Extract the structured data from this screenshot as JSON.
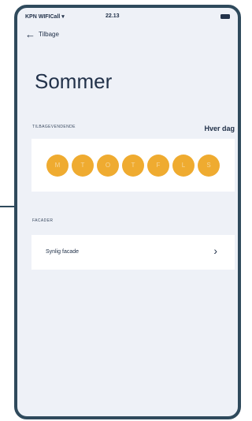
{
  "status_bar": {
    "carrier": "KPN WIFICall",
    "time": "22.13"
  },
  "nav": {
    "back_label": "Tilbage"
  },
  "title": "Sommer",
  "schedule": {
    "section_label": "TILBAGEVENDENDE",
    "repeat_value": "Hver dag",
    "days": [
      "M",
      "T",
      "O",
      "T",
      "F",
      "L",
      "S"
    ],
    "active_color": "#efab30"
  },
  "facades": {
    "section_label": "FACADER",
    "items": [
      {
        "label": "Synlig facade"
      }
    ]
  },
  "icons": {
    "back": "back-arrow-icon",
    "chevron": "chevron-right-icon",
    "wifi": "wifi-icon",
    "battery": "battery-icon"
  }
}
